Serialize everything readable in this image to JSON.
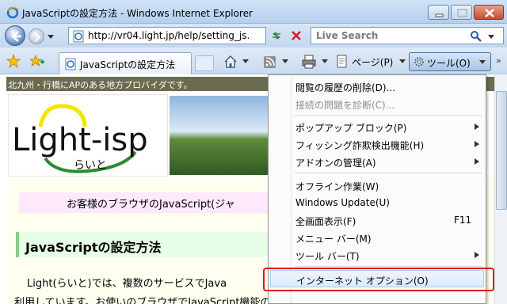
{
  "window": {
    "title": "JavaScriptの設定方法 - Windows Internet Explorer"
  },
  "address_bar": {
    "url": "http://vr04.light.jp/help/setting_js.",
    "search_placeholder": "Live Search"
  },
  "tab": {
    "label": "JavaScriptの設定方法"
  },
  "command_bar": {
    "page_label": "ページ(P)",
    "tools_label": "ツール(O)"
  },
  "page": {
    "banner": "北九州・行橋にAPのある地方プロバイダです。",
    "logo_text": "Light-isp",
    "logo_sub": "らいと",
    "notice": "お客様のブラウザのJavaScript(ジャ",
    "heading": "JavaScriptの設定方法",
    "para1": "Light(らいと)では、複数のサービスでJava",
    "para2": "利用しています。お使いのブラウザでJavaScript機能の設定がオフになっ"
  },
  "tools_menu": {
    "items": [
      {
        "label": "閲覧の履歴の削除(D)...",
        "disabled": false,
        "submenu": false,
        "shortcut": ""
      },
      {
        "label": "接続の問題を診断(C)...",
        "disabled": true,
        "submenu": false,
        "shortcut": ""
      },
      {
        "label": "ポップアップ ブロック(P)",
        "disabled": false,
        "submenu": true,
        "shortcut": ""
      },
      {
        "label": "フィッシング詐欺検出機能(H)",
        "disabled": false,
        "submenu": true,
        "shortcut": ""
      },
      {
        "label": "アドオンの管理(A)",
        "disabled": false,
        "submenu": true,
        "shortcut": ""
      },
      {
        "label": "オフライン作業(W)",
        "disabled": false,
        "submenu": false,
        "shortcut": ""
      },
      {
        "label": "Windows Update(U)",
        "disabled": false,
        "submenu": false,
        "shortcut": ""
      },
      {
        "label": "全画面表示(F)",
        "disabled": false,
        "submenu": false,
        "shortcut": "F11"
      },
      {
        "label": "メニュー バー(M)",
        "disabled": false,
        "submenu": false,
        "shortcut": ""
      },
      {
        "label": "ツール バー(T)",
        "disabled": false,
        "submenu": true,
        "shortcut": ""
      },
      {
        "label": "インターネット オプション(O)",
        "disabled": false,
        "submenu": false,
        "shortcut": ""
      }
    ]
  },
  "colors": {
    "highlight_border": "#e8101a",
    "banner_bg": "#6b6b4f"
  }
}
